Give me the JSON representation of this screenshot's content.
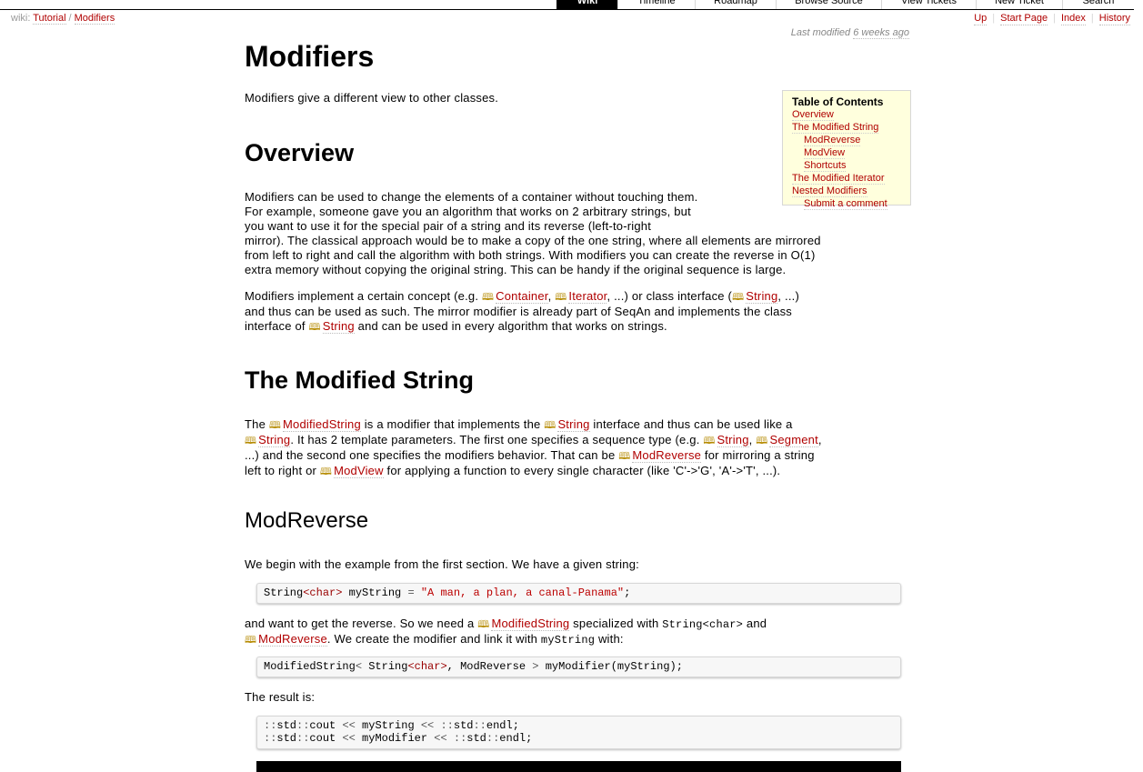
{
  "mainnav": {
    "items": [
      {
        "label": "Wiki",
        "active": true
      },
      {
        "label": "Timeline",
        "active": false
      },
      {
        "label": "Roadmap",
        "active": false
      },
      {
        "label": "Browse Source",
        "active": false
      },
      {
        "label": "View Tickets",
        "active": false
      },
      {
        "label": "New Ticket",
        "active": false
      },
      {
        "label": "Search",
        "active": false
      }
    ]
  },
  "breadcrumb": {
    "prefix": "wiki:",
    "items": [
      "Tutorial",
      "Modifiers"
    ],
    "sep": "/"
  },
  "ctxnav": [
    "Up",
    "Start Page",
    "Index",
    "History"
  ],
  "lastmod": {
    "prefix": "Last modified",
    "age": "6 weeks ago"
  },
  "page": {
    "title": "Modifiers",
    "intro": "Modifiers give a different view to other classes."
  },
  "toc": {
    "title": "Table of Contents",
    "items": [
      {
        "label": "Overview",
        "level": 1
      },
      {
        "label": "The Modified String",
        "level": 1
      },
      {
        "label": "ModReverse",
        "level": 2
      },
      {
        "label": "ModView",
        "level": 2
      },
      {
        "label": "Shortcuts",
        "level": 2
      },
      {
        "label": "The Modified Iterator",
        "level": 1
      },
      {
        "label": "Nested Modifiers",
        "level": 1
      },
      {
        "label": "Submit a comment",
        "level": 2
      }
    ]
  },
  "overview": {
    "heading": "Overview",
    "p1_lines": [
      "Modifiers can be used to change the elements of a container without touching them.",
      "For example, someone gave you an algorithm that works on 2 arbitrary strings, but",
      "you want to use it for the special pair of a string and its reverse (left-to-right",
      "mirror). The classical approach would be to make a copy of the one string, where all elements are mirrored",
      "from left to right and call the algorithm with both strings. With modifiers you can create the reverse in O(1)",
      "extra memory without copying the original string. This can be handy if the original sequence is large."
    ],
    "p2": {
      "t1": "Modifiers implement a certain concept (e.g. ",
      "l1": "Container",
      "t2": ", ",
      "l2": "Iterator",
      "t3": ", ...) or class interface (",
      "l3": "String",
      "t4": ", ...)",
      "t5": "and thus can be used as such. The mirror modifier is already part of SeqAn and implements the class",
      "t6": "interface of ",
      "l4": "String",
      "t7": " and can be used in every algorithm that works on strings."
    }
  },
  "modstring": {
    "heading": "The Modified String",
    "p": {
      "t1": "The ",
      "l1": "ModifiedString",
      "t2": " is a modifier that implements the ",
      "l2": "String",
      "t3": " interface and thus can be used like a",
      "l3": "String",
      "t4": ". It has 2 template parameters. The first one specifies a sequence type (e.g. ",
      "l4": "String",
      "t5": ", ",
      "l5": "Segment",
      "t6": ",",
      "t7": "...) and the second one specifies the modifiers behavior. That can be ",
      "l6": "ModReverse",
      "t8": " for mirroring a string",
      "t9": "left to right or ",
      "l7": "ModView",
      "t10": " for applying a function to every single character (like 'C'->'G', 'A'->'T', ...)."
    }
  },
  "modreverse": {
    "heading": "ModReverse",
    "p1": "We begin with the example from the first section. We have a given string:",
    "code1": {
      "a": "String",
      "b": "<",
      "c": "char",
      "d": ">",
      "e": " myString ",
      "f": "=",
      "g": " ",
      "h": "\"A man, a plan, a canal-Panama\"",
      "i": ";"
    },
    "p2": {
      "t1": "and want to get the reverse. So we need a ",
      "l1": "ModifiedString",
      "t2": " specialized with ",
      "c1": "String<char>",
      "t3": " and",
      "l2": "ModReverse",
      "t4": ". We create the modifier and link it with ",
      "c2": "myString",
      "t5": " with:"
    },
    "code2": {
      "a": "ModifiedString",
      "b": "<",
      "c": " String",
      "d": "<",
      "e": "char",
      "f": ">",
      "g": ", ModReverse ",
      "h": ">",
      "i": " myModifier(myString);"
    },
    "p3": "The result is:",
    "code3": {
      "l1a": "::",
      "l1b": "std",
      "l1c": "::",
      "l1d": "cout ",
      "l1e": "<<",
      "l1f": " myString ",
      "l1g": "<<",
      "l1h": " ",
      "l1i": "::",
      "l1j": "std",
      "l1k": "::",
      "l1l": "endl;",
      "l2a": "::",
      "l2b": "std",
      "l2c": "::",
      "l2d": "cout ",
      "l2e": "<<",
      "l2f": " myModifier ",
      "l2g": "<<",
      "l2h": " ",
      "l2i": "::",
      "l2j": "std",
      "l2k": "::",
      "l2l": "endl;"
    }
  },
  "icon_glyph": "🕮",
  "colors": {
    "link": "#b00000",
    "toc_bg": "#ffffdd",
    "code_bg": "#f7f7f7",
    "nav_active": "#000000"
  }
}
